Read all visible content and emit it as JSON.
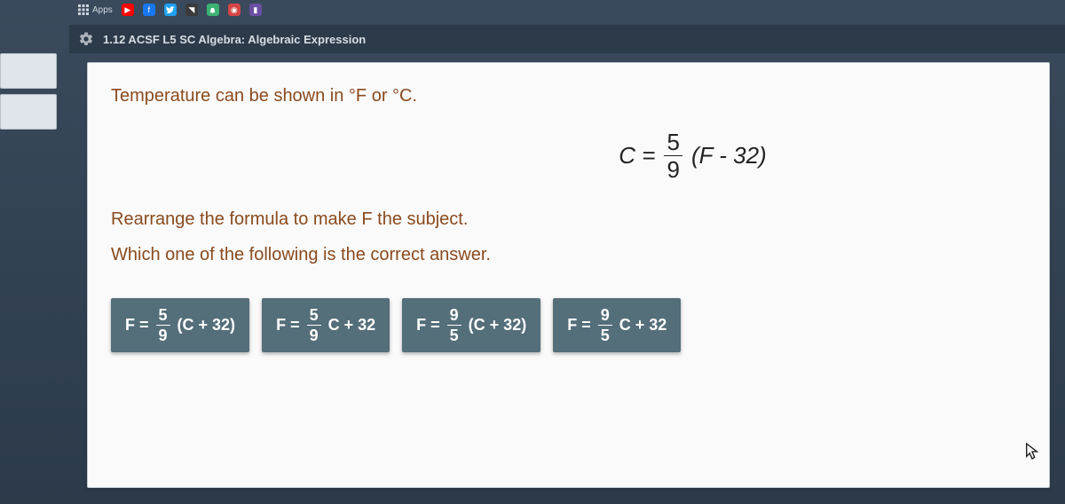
{
  "bookmarks": {
    "apps_label": "Apps"
  },
  "title_bar": {
    "text": "1.12 ACSF L5 SC Algebra: Algebraic Expression"
  },
  "question": {
    "line1": "Temperature can be shown in °F or °C.",
    "line2": "Rearrange the formula to make F the subject.",
    "line3": "Which one of the following is the correct answer."
  },
  "formula": {
    "lhs": "C =",
    "frac_num": "5",
    "frac_den": "9",
    "rhs": "(F - 32)"
  },
  "answers": [
    {
      "prefix": "F =",
      "num": "5",
      "den": "9",
      "suffix": "(C + 32)"
    },
    {
      "prefix": "F =",
      "num": "5",
      "den": "9",
      "suffix": "C + 32"
    },
    {
      "prefix": "F =",
      "num": "9",
      "den": "5",
      "suffix": "(C + 32)"
    },
    {
      "prefix": "F =",
      "num": "9",
      "den": "5",
      "suffix": "C + 32"
    }
  ]
}
